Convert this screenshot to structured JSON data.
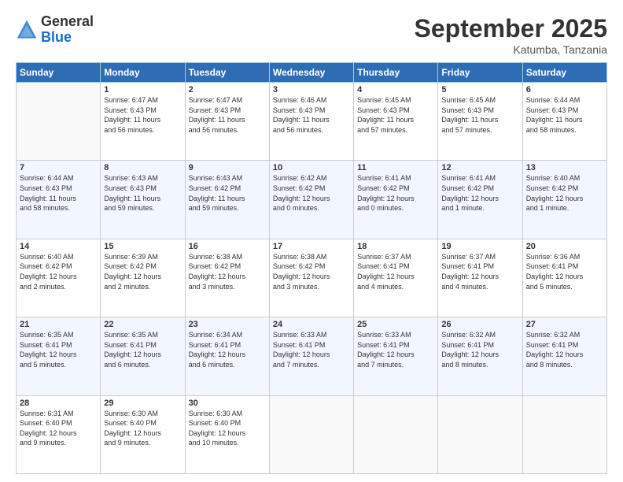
{
  "header": {
    "logo_general": "General",
    "logo_blue": "Blue",
    "month_title": "September 2025",
    "location": "Katumba, Tanzania"
  },
  "calendar": {
    "headers": [
      "Sunday",
      "Monday",
      "Tuesday",
      "Wednesday",
      "Thursday",
      "Friday",
      "Saturday"
    ],
    "weeks": [
      [
        {
          "day": "",
          "info": ""
        },
        {
          "day": "1",
          "info": "Sunrise: 6:47 AM\nSunset: 6:43 PM\nDaylight: 11 hours\nand 56 minutes."
        },
        {
          "day": "2",
          "info": "Sunrise: 6:47 AM\nSunset: 6:43 PM\nDaylight: 11 hours\nand 56 minutes."
        },
        {
          "day": "3",
          "info": "Sunrise: 6:46 AM\nSunset: 6:43 PM\nDaylight: 11 hours\nand 56 minutes."
        },
        {
          "day": "4",
          "info": "Sunrise: 6:45 AM\nSunset: 6:43 PM\nDaylight: 11 hours\nand 57 minutes."
        },
        {
          "day": "5",
          "info": "Sunrise: 6:45 AM\nSunset: 6:43 PM\nDaylight: 11 hours\nand 57 minutes."
        },
        {
          "day": "6",
          "info": "Sunrise: 6:44 AM\nSunset: 6:43 PM\nDaylight: 11 hours\nand 58 minutes."
        }
      ],
      [
        {
          "day": "7",
          "info": "Sunrise: 6:44 AM\nSunset: 6:43 PM\nDaylight: 11 hours\nand 58 minutes."
        },
        {
          "day": "8",
          "info": "Sunrise: 6:43 AM\nSunset: 6:43 PM\nDaylight: 11 hours\nand 59 minutes."
        },
        {
          "day": "9",
          "info": "Sunrise: 6:43 AM\nSunset: 6:42 PM\nDaylight: 11 hours\nand 59 minutes."
        },
        {
          "day": "10",
          "info": "Sunrise: 6:42 AM\nSunset: 6:42 PM\nDaylight: 12 hours\nand 0 minutes."
        },
        {
          "day": "11",
          "info": "Sunrise: 6:41 AM\nSunset: 6:42 PM\nDaylight: 12 hours\nand 0 minutes."
        },
        {
          "day": "12",
          "info": "Sunrise: 6:41 AM\nSunset: 6:42 PM\nDaylight: 12 hours\nand 1 minute."
        },
        {
          "day": "13",
          "info": "Sunrise: 6:40 AM\nSunset: 6:42 PM\nDaylight: 12 hours\nand 1 minute."
        }
      ],
      [
        {
          "day": "14",
          "info": "Sunrise: 6:40 AM\nSunset: 6:42 PM\nDaylight: 12 hours\nand 2 minutes."
        },
        {
          "day": "15",
          "info": "Sunrise: 6:39 AM\nSunset: 6:42 PM\nDaylight: 12 hours\nand 2 minutes."
        },
        {
          "day": "16",
          "info": "Sunrise: 6:38 AM\nSunset: 6:42 PM\nDaylight: 12 hours\nand 3 minutes."
        },
        {
          "day": "17",
          "info": "Sunrise: 6:38 AM\nSunset: 6:42 PM\nDaylight: 12 hours\nand 3 minutes."
        },
        {
          "day": "18",
          "info": "Sunrise: 6:37 AM\nSunset: 6:41 PM\nDaylight: 12 hours\nand 4 minutes."
        },
        {
          "day": "19",
          "info": "Sunrise: 6:37 AM\nSunset: 6:41 PM\nDaylight: 12 hours\nand 4 minutes."
        },
        {
          "day": "20",
          "info": "Sunrise: 6:36 AM\nSunset: 6:41 PM\nDaylight: 12 hours\nand 5 minutes."
        }
      ],
      [
        {
          "day": "21",
          "info": "Sunrise: 6:35 AM\nSunset: 6:41 PM\nDaylight: 12 hours\nand 5 minutes."
        },
        {
          "day": "22",
          "info": "Sunrise: 6:35 AM\nSunset: 6:41 PM\nDaylight: 12 hours\nand 6 minutes."
        },
        {
          "day": "23",
          "info": "Sunrise: 6:34 AM\nSunset: 6:41 PM\nDaylight: 12 hours\nand 6 minutes."
        },
        {
          "day": "24",
          "info": "Sunrise: 6:33 AM\nSunset: 6:41 PM\nDaylight: 12 hours\nand 7 minutes."
        },
        {
          "day": "25",
          "info": "Sunrise: 6:33 AM\nSunset: 6:41 PM\nDaylight: 12 hours\nand 7 minutes."
        },
        {
          "day": "26",
          "info": "Sunrise: 6:32 AM\nSunset: 6:41 PM\nDaylight: 12 hours\nand 8 minutes."
        },
        {
          "day": "27",
          "info": "Sunrise: 6:32 AM\nSunset: 6:41 PM\nDaylight: 12 hours\nand 8 minutes."
        }
      ],
      [
        {
          "day": "28",
          "info": "Sunrise: 6:31 AM\nSunset: 6:40 PM\nDaylight: 12 hours\nand 9 minutes."
        },
        {
          "day": "29",
          "info": "Sunrise: 6:30 AM\nSunset: 6:40 PM\nDaylight: 12 hours\nand 9 minutes."
        },
        {
          "day": "30",
          "info": "Sunrise: 6:30 AM\nSunset: 6:40 PM\nDaylight: 12 hours\nand 10 minutes."
        },
        {
          "day": "",
          "info": ""
        },
        {
          "day": "",
          "info": ""
        },
        {
          "day": "",
          "info": ""
        },
        {
          "day": "",
          "info": ""
        }
      ]
    ]
  }
}
